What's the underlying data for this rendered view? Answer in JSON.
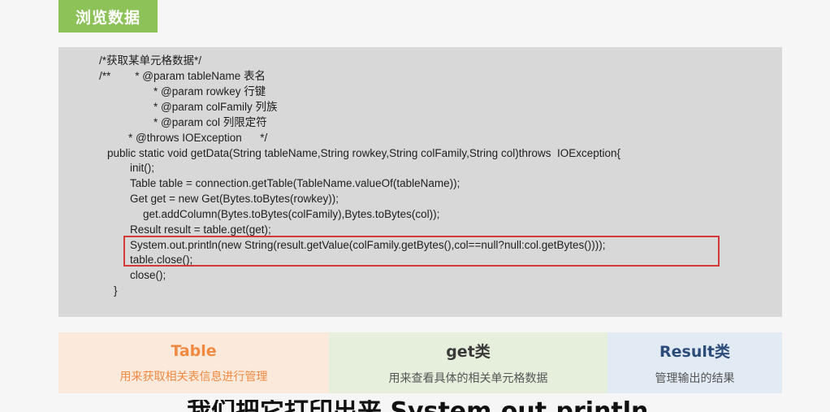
{
  "header": {
    "title": "浏览数据"
  },
  "code": {
    "lines": [
      "/*获取某单元格数据*/",
      "/**        * @param tableName 表名",
      "* @param rowkey 行键",
      "* @param colFamily 列族",
      "* @param col 列限定符",
      "* @throws IOException      */",
      "public static void getData(String tableName,String rowkey,String colFamily,String col)throws  IOException{",
      "init();",
      "Table table = connection.getTable(TableName.valueOf(tableName));",
      "Get get = new Get(Bytes.toBytes(rowkey));",
      "get.addColumn(Bytes.toBytes(colFamily),Bytes.toBytes(col));",
      "Result result = table.get(get);",
      "System.out.println(new String(result.getValue(colFamily.getBytes(),col==null?null:col.getBytes())));",
      "table.close();",
      "close();",
      "}"
    ]
  },
  "cards": [
    {
      "title": "Table",
      "desc": "用来获取相关表信息进行管理"
    },
    {
      "title": "get类",
      "desc": "用来查看具体的相关单元格数据"
    },
    {
      "title": "Result类",
      "desc": "管理输出的结果"
    }
  ],
  "subtitle": "我们把它打印出来 System.out.println"
}
